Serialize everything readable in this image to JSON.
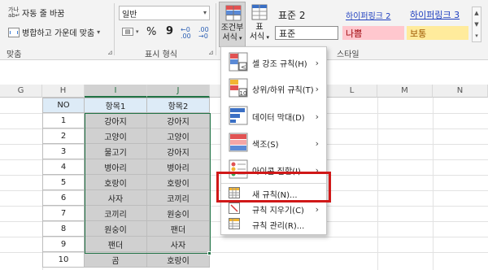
{
  "ribbon": {
    "wrap_text": "자동 줄 바꿈",
    "merge_center": "병합하고 가운데 맞춤",
    "merge_arrow": "▾",
    "number_format_value": "일반",
    "percent_symbol": "%",
    "comma_symbol": "9",
    "align_group_label": "맞춤",
    "number_group_label": "표시 형식",
    "style_group_label": "스타일",
    "cond_format_line1": "조건부",
    "cond_format_line2": "서식",
    "table_format_line1": "표",
    "table_format_line2": "서식",
    "styles": {
      "normal2": "표준 2",
      "hyperlink2": "하이퍼링크 2",
      "hyperlink3": "하이퍼링크 3",
      "normal": "표준",
      "bad": "나쁨",
      "neutral": "보통"
    },
    "colors": {
      "bad_bg": "#ffc7ce",
      "bad_fg": "#9c0006",
      "neutral_bg": "#ffeb9c",
      "neutral_fg": "#9c5700",
      "hyperlink": "#1f3fbf",
      "accent_green": "#217346"
    }
  },
  "columns": [
    "G",
    "H",
    "I",
    "J",
    "K",
    "L",
    "M",
    "N"
  ],
  "table": {
    "headers": [
      "NO",
      "항목1",
      "항목2"
    ],
    "rows": [
      [
        "1",
        "강아지",
        "강아지"
      ],
      [
        "2",
        "고양이",
        "고양이"
      ],
      [
        "3",
        "물고기",
        "강아지"
      ],
      [
        "4",
        "병아리",
        "병아리"
      ],
      [
        "5",
        "호랑이",
        "호랑이"
      ],
      [
        "6",
        "사자",
        "코끼리"
      ],
      [
        "7",
        "코끼리",
        "원숭이"
      ],
      [
        "8",
        "원숭이",
        "팬더"
      ],
      [
        "9",
        "팬더",
        "사자"
      ],
      [
        "10",
        "곰",
        "호랑이"
      ]
    ]
  },
  "menu": {
    "items": [
      {
        "label": "셀 강조 규칙(H)",
        "icon": "highlight-cells-icon",
        "submenu": true
      },
      {
        "label": "상위/하위 규칙(T)",
        "icon": "top-bottom-rules-icon",
        "submenu": true
      },
      {
        "label": "데이터 막대(D)",
        "icon": "data-bars-icon",
        "submenu": true
      },
      {
        "label": "색조(S)",
        "icon": "color-scales-icon",
        "submenu": true
      },
      {
        "label": "아이콘 집합(I)",
        "icon": "icon-sets-icon",
        "submenu": true
      },
      {
        "label": "새 규칙(N)...",
        "icon": "new-rule-icon",
        "submenu": false
      },
      {
        "label": "규칙 지우기(C)",
        "icon": "clear-rules-icon",
        "submenu": true
      },
      {
        "label": "규칙 관리(R)...",
        "icon": "manage-rules-icon",
        "submenu": false
      }
    ]
  }
}
